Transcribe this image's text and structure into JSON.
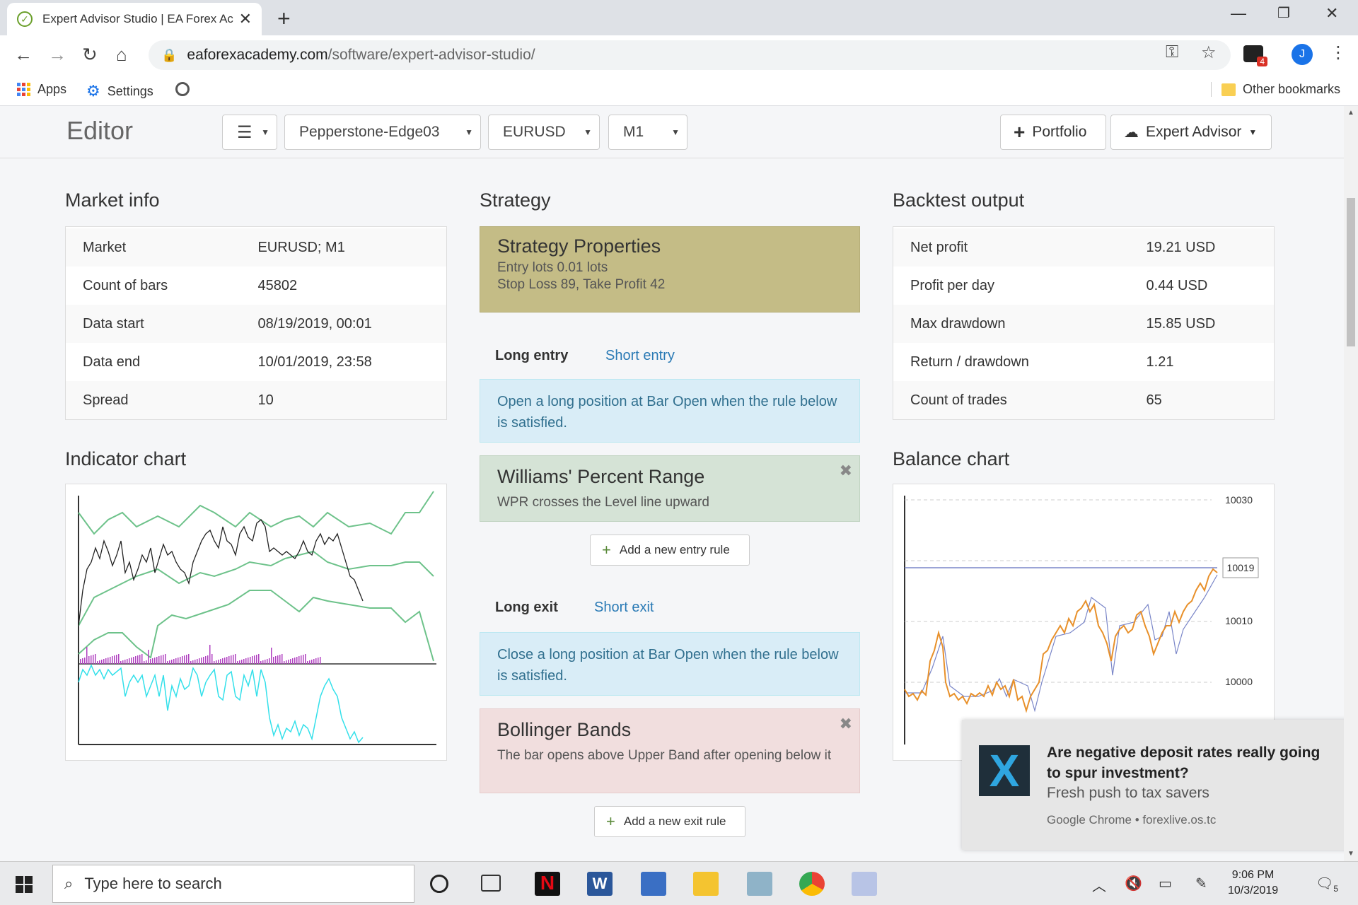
{
  "browser": {
    "tab_title": "Expert Advisor Studio | EA Forex Academy",
    "url_host": "eaforexacademy.com",
    "url_path": "/software/expert-advisor-studio/",
    "bookmarks": {
      "apps": "Apps",
      "settings": "Settings",
      "other": "Other bookmarks"
    },
    "ext_badge": "4",
    "avatar": "J"
  },
  "editor": {
    "title": "Editor",
    "server": "Pepperstone-Edge03",
    "symbol": "EURUSD",
    "period": "M1",
    "portfolio_label": "Portfolio",
    "ea_label": "Expert Advisor"
  },
  "market_info": {
    "title": "Market info",
    "rows": [
      {
        "k": "Market",
        "v": "EURUSD; M1"
      },
      {
        "k": "Count of bars",
        "v": "45802"
      },
      {
        "k": "Data start",
        "v": "08/19/2019, 00:01"
      },
      {
        "k": "Data end",
        "v": "10/01/2019, 23:58"
      },
      {
        "k": "Spread",
        "v": "10"
      }
    ]
  },
  "indicator_chart": {
    "title": "Indicator chart"
  },
  "strategy": {
    "title": "Strategy",
    "props_title": "Strategy Properties",
    "props_line1": "Entry lots 0.01 lots",
    "props_line2": "Stop Loss 89, Take Profit 42",
    "long_entry": "Long entry",
    "short_entry": "Short entry",
    "entry_info": "Open a long position at Bar Open when the rule below is satisfied.",
    "entry_rule_title": "Williams' Percent Range",
    "entry_rule_desc": "WPR crosses the Level line upward",
    "add_entry": "Add a new entry rule",
    "long_exit": "Long exit",
    "short_exit": "Short exit",
    "exit_info": "Close a long position at Bar Open when the rule below is satisfied.",
    "exit_rule_title": "Bollinger Bands",
    "exit_rule_desc": "The bar opens above Upper Band after opening below it",
    "add_exit": "Add a new exit rule"
  },
  "backtest": {
    "title": "Backtest output",
    "rows": [
      {
        "k": "Net profit",
        "v": "19.21 USD"
      },
      {
        "k": "Profit per day",
        "v": "0.44 USD"
      },
      {
        "k": "Max drawdown",
        "v": "15.85 USD"
      },
      {
        "k": "Return / drawdown",
        "v": "1.21"
      },
      {
        "k": "Count of trades",
        "v": "65"
      }
    ]
  },
  "balance_chart": {
    "title": "Balance chart",
    "ticks": [
      "10030",
      "10010",
      "10000"
    ],
    "current_label": "10019"
  },
  "notification": {
    "title": "Are negative deposit rates really going to spur investment?",
    "subtitle": "Fresh push to tax savers",
    "source": "Google Chrome • forexlive.os.tc"
  },
  "taskbar": {
    "search_placeholder": "Type here to search",
    "time": "9:06 PM",
    "date": "10/3/2019",
    "notif_count": "5"
  },
  "colors": {
    "props_bg": "#c4bc86",
    "info_bg": "#d9edf7",
    "entry_rule_bg": "#d5e3d6",
    "exit_rule_bg": "#f1dede",
    "link": "#2a7ab5"
  }
}
